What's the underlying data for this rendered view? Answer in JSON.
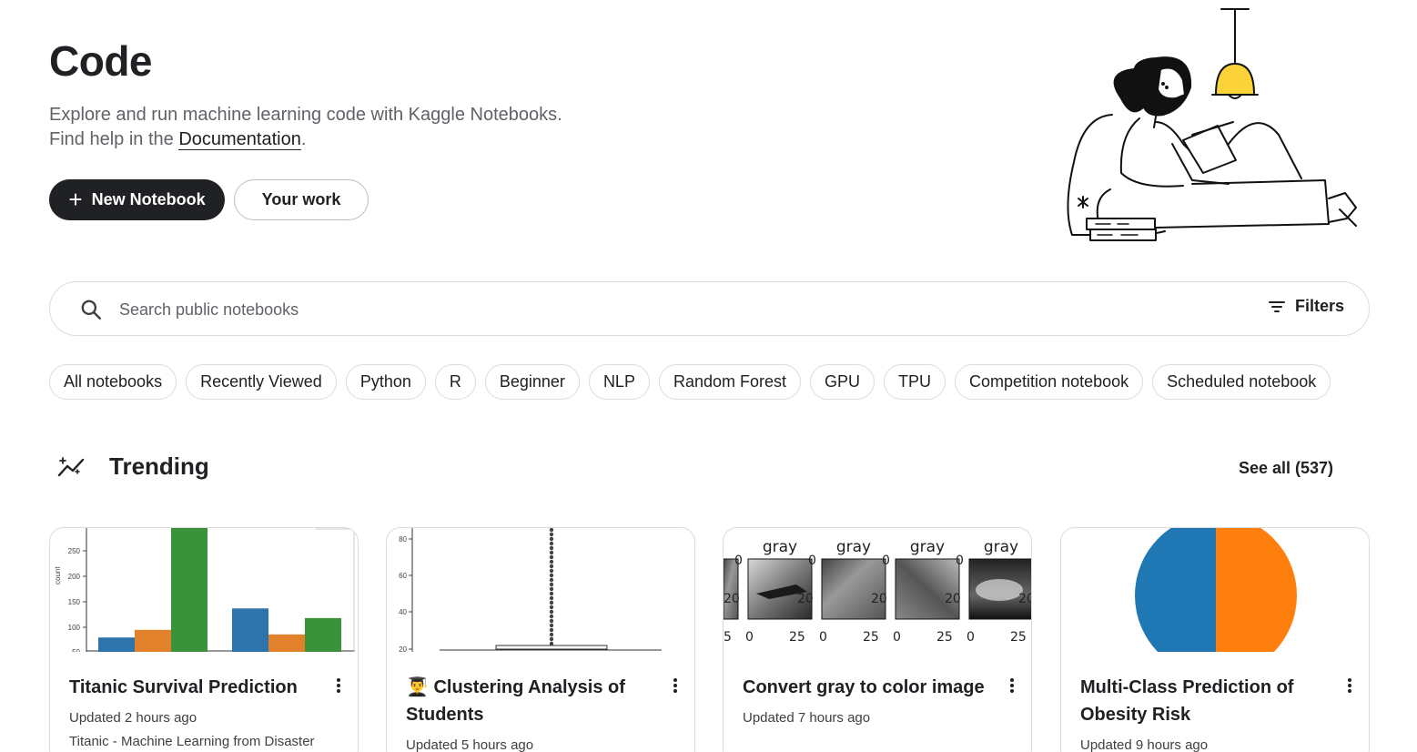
{
  "header": {
    "title": "Code",
    "subtitle_line1": "Explore and run machine learning code with Kaggle Notebooks.",
    "subtitle_line2_prefix": "Find help in the ",
    "documentation_link": "Documentation",
    "subtitle_line2_suffix": "."
  },
  "actions": {
    "new_notebook": "New Notebook",
    "your_work": "Your work"
  },
  "search": {
    "placeholder": "Search public notebooks",
    "filters_label": "Filters"
  },
  "chips": [
    "All notebooks",
    "Recently Viewed",
    "Python",
    "R",
    "Beginner",
    "NLP",
    "Random Forest",
    "GPU",
    "TPU",
    "Competition notebook",
    "Scheduled notebook"
  ],
  "trending": {
    "title": "Trending",
    "see_all": "See all (537)"
  },
  "cards": [
    {
      "title": "Titanic Survival Prediction",
      "updated": "Updated 2 hours ago",
      "source": "Titanic - Machine Learning from Disaster",
      "thumb": {
        "ylabel": "count",
        "ticks": [
          "250",
          "200",
          "150",
          "100",
          "50"
        ],
        "bars": [
          80,
          95,
          300,
          137,
          86,
          118
        ]
      }
    },
    {
      "title": "👨‍🎓 Clustering Analysis of Students",
      "updated": "Updated 5 hours ago",
      "thumb": {
        "ticks": [
          "80",
          "60",
          "40",
          "20"
        ]
      }
    },
    {
      "title": "Convert gray to color image",
      "updated": "Updated 7 hours ago",
      "thumb": {
        "panel_title": "gray",
        "tick_left": "0",
        "tick_mid": "20",
        "tick_right": "25",
        "tick_edge": "5"
      }
    },
    {
      "title": "Multi-Class Prediction of Obesity Risk",
      "updated": "Updated 9 hours ago",
      "thumb": {
        "colors": [
          "#1f77b4",
          "#ff7f0e"
        ]
      }
    }
  ]
}
